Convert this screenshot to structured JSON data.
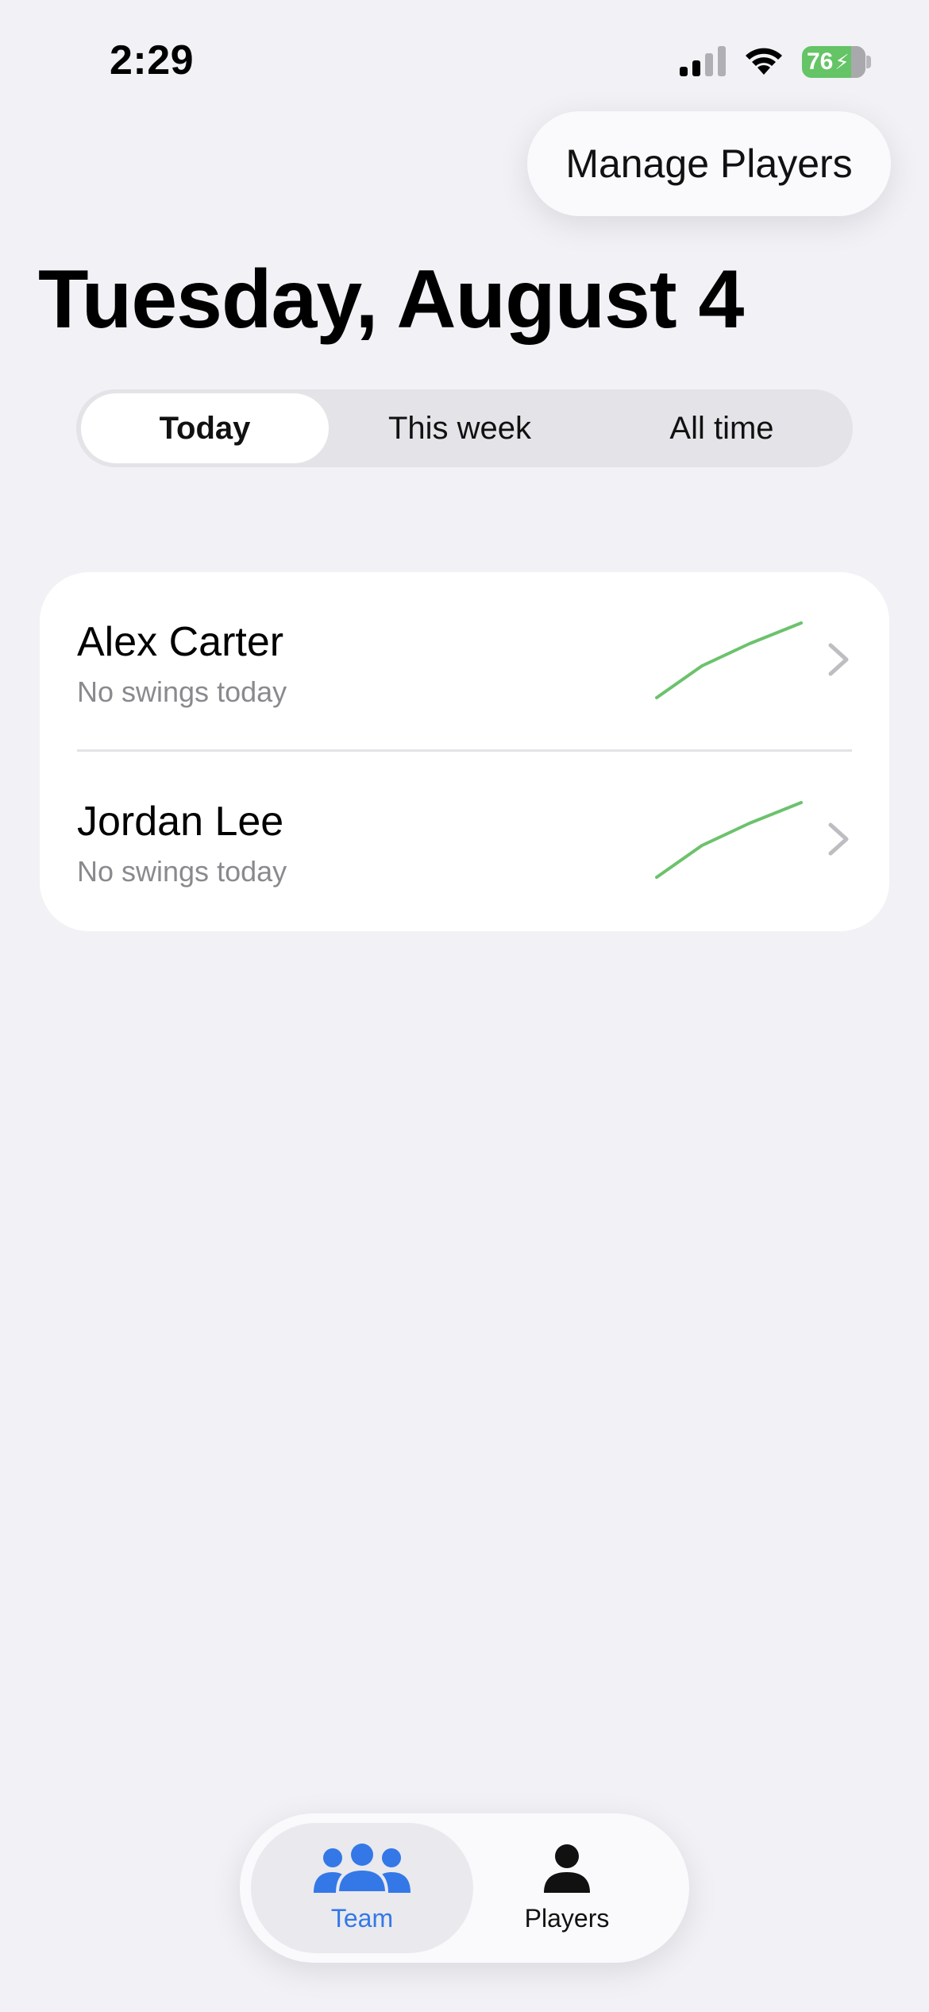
{
  "status": {
    "time": "2:29",
    "battery": "76"
  },
  "header": {
    "manage_label": "Manage Players",
    "title": "Tuesday, August 4"
  },
  "segments": [
    {
      "label": "Today",
      "active": true
    },
    {
      "label": "This week",
      "active": false
    },
    {
      "label": "All time",
      "active": false
    }
  ],
  "players": [
    {
      "name": "Alex Carter",
      "subtitle": "No swings today"
    },
    {
      "name": "Jordan Lee",
      "subtitle": "No swings today"
    }
  ],
  "tabs": [
    {
      "label": "Team",
      "selected": true
    },
    {
      "label": "Players",
      "selected": false
    }
  ],
  "colors": {
    "accent": "#3478e7",
    "spark": "#6cc26c",
    "battery": "#64c466",
    "background": "#f1f1f6"
  },
  "icons": {
    "team": "team-icon",
    "players": "person-icon",
    "row_chevron": "chevron-right-icon"
  }
}
